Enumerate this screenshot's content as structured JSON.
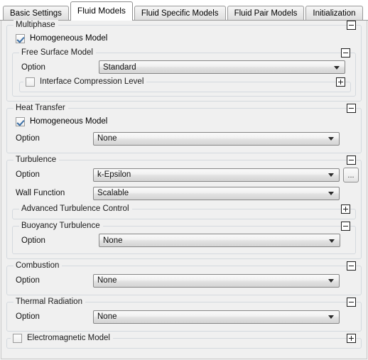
{
  "window": {
    "title": "Fluid Models"
  },
  "tabs": [
    {
      "label": "Basic Settings",
      "active": false
    },
    {
      "label": "Fluid Models",
      "active": true
    },
    {
      "label": "Fluid Specific Models",
      "active": false
    },
    {
      "label": "Fluid Pair Models",
      "active": false
    },
    {
      "label": "Initialization",
      "active": false
    }
  ],
  "labels": {
    "option": "Option",
    "wall_function": "Wall Function"
  },
  "sections": {
    "multiphase": {
      "title": "Multiphase",
      "toggle": "minus",
      "homogeneous_model": {
        "label": "Homogeneous Model",
        "checked": true
      },
      "free_surface_model": {
        "title": "Free Surface Model",
        "toggle": "minus",
        "option_label": "Option",
        "option_value": "Standard"
      },
      "interface_compression": {
        "title": "Interface Compression Level",
        "checked": false,
        "toggle": "plus"
      }
    },
    "heat_transfer": {
      "title": "Heat Transfer",
      "toggle": "minus",
      "homogeneous_model": {
        "label": "Homogeneous Model",
        "checked": true
      },
      "option_label": "Option",
      "option_value": "None"
    },
    "turbulence": {
      "title": "Turbulence",
      "toggle": "minus",
      "option_label": "Option",
      "option_value": "k-Epsilon",
      "ellipsis_button": "...",
      "wall_function_label": "Wall Function",
      "wall_function_value": "Scalable",
      "advanced_turbulence_control": {
        "title": "Advanced Turbulence Control",
        "toggle": "plus"
      },
      "buoyancy_turbulence": {
        "title": "Buoyancy Turbulence",
        "toggle": "minus",
        "option_label": "Option",
        "option_value": "None"
      }
    },
    "combustion": {
      "title": "Combustion",
      "toggle": "minus",
      "option_label": "Option",
      "option_value": "None"
    },
    "thermal_radiation": {
      "title": "Thermal Radiation",
      "toggle": "minus",
      "option_label": "Option",
      "option_value": "None"
    },
    "electromagnetic_model": {
      "title": "Electromagnetic Model",
      "checked": false,
      "toggle": "plus"
    }
  },
  "colors": {
    "panel_background": "#f0f0f0",
    "group_border": "#d4d9de",
    "combo_border": "#868686",
    "check_mark": "#3a6ea5",
    "tab_border": "#9a9a9a"
  }
}
